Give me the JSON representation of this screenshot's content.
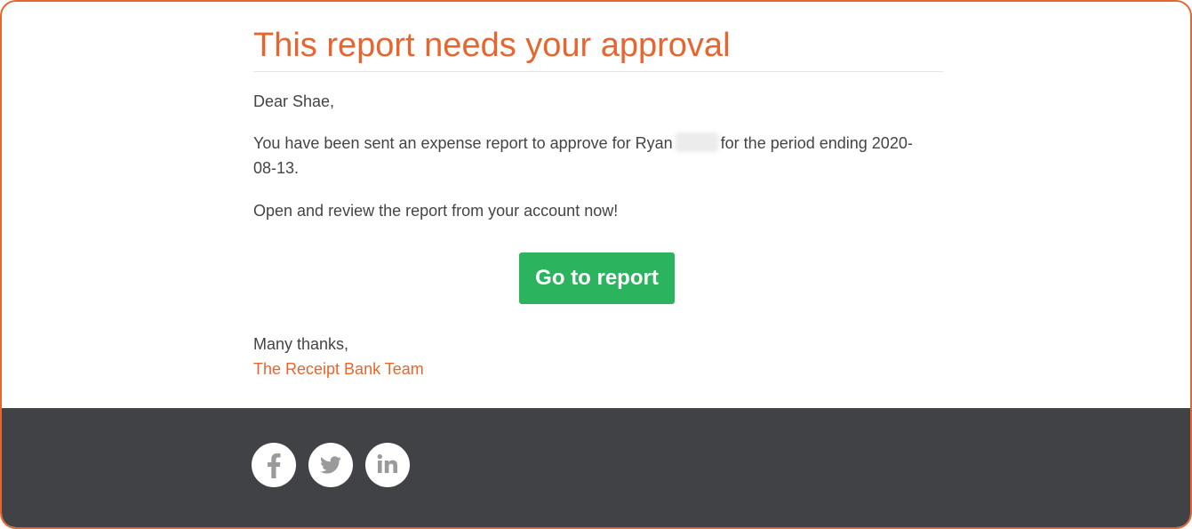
{
  "email": {
    "title": "This report needs your approval",
    "greeting": "Dear Shae,",
    "body_before_name": "You have been sent an expense report to approve for Ryan",
    "body_after_name": "for the period ending 2020-08-13.",
    "body2": "Open and review the report from your account now!",
    "cta_label": "Go to report",
    "signoff": "Many thanks,",
    "team": "The Receipt Bank Team"
  },
  "footer": {
    "social": [
      {
        "name": "facebook",
        "icon": "facebook-icon"
      },
      {
        "name": "twitter",
        "icon": "twitter-icon"
      },
      {
        "name": "linkedin",
        "icon": "linkedin-icon"
      }
    ]
  },
  "colors": {
    "accent": "#e8662e",
    "button": "#2bb35e",
    "footer": "#414245",
    "text": "#444444",
    "icon": "#9a9a9a"
  }
}
